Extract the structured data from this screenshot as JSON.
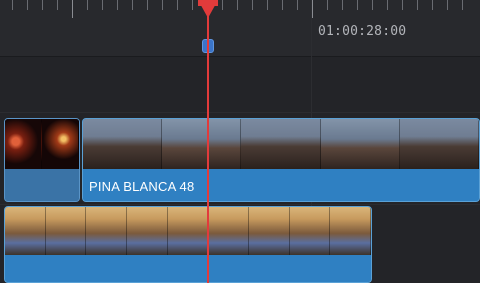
{
  "ruler": {
    "timecode": "01:00:28:00"
  },
  "tracks": {
    "video2": {
      "clips": [
        {
          "name": "fire-clip",
          "label": ""
        },
        {
          "name": "pina-blanca-clip",
          "label": "PINA BLANCA 48"
        }
      ]
    },
    "video1": {
      "clips": [
        {
          "name": "room-clip",
          "label": ""
        }
      ]
    }
  },
  "colors": {
    "playhead": "#e23b3b",
    "clip": "#2a78b8",
    "marker": "#3b74c8"
  }
}
